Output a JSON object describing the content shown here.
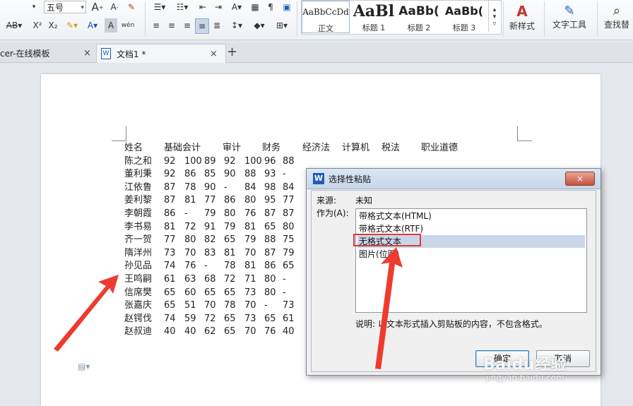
{
  "ribbon": {
    "font_size": "五号",
    "styles": [
      {
        "sample": "AaBbCcDd",
        "label": "正文"
      },
      {
        "sample": "AaBl",
        "label": "标题 1"
      },
      {
        "sample": "AaBb(",
        "label": "标题 2"
      },
      {
        "sample": "AaBb(",
        "label": "标题 3"
      }
    ],
    "new_style": "新样式",
    "text_tools": "文字工具",
    "find_replace": "查找替"
  },
  "tabs": {
    "template_tab": "cer-在线模板",
    "doc_tab": "文档1 *",
    "close_glyph": "×",
    "new_tab": "+"
  },
  "table": {
    "headers": [
      "姓名",
      "基础会计",
      "审计",
      "财务",
      "经济法",
      "计算机",
      "税法",
      "职业道德"
    ],
    "rows": [
      [
        "陈之和",
        "92",
        "100",
        "89",
        "92",
        "100",
        "96",
        "88"
      ],
      [
        "董利秉",
        "92",
        "86",
        "85",
        "90",
        "88",
        "93",
        "-"
      ],
      [
        "江依鲁",
        "87",
        "78",
        "90",
        "-",
        "84",
        "98",
        "84"
      ],
      [
        "姜利黎",
        "87",
        "81",
        "77",
        "86",
        "80",
        "95",
        "77"
      ],
      [
        "李朝霞",
        "86",
        "-",
        "79",
        "80",
        "76",
        "87",
        "87"
      ],
      [
        "李书易",
        "81",
        "72",
        "91",
        "79",
        "81",
        "65",
        "80"
      ],
      [
        "齐一贺",
        "77",
        "80",
        "82",
        "65",
        "79",
        "88",
        "75"
      ],
      [
        "隋洋州",
        "73",
        "70",
        "83",
        "81",
        "70",
        "87",
        "79"
      ],
      [
        "孙见品",
        "74",
        "76",
        "-",
        "78",
        "81",
        "86",
        "65"
      ],
      [
        "王鸣嗣",
        "61",
        "63",
        "68",
        "72",
        "71",
        "80",
        "-"
      ],
      [
        "信席樊",
        "65",
        "60",
        "65",
        "65",
        "73",
        "80",
        "-"
      ],
      [
        "张嘉庆",
        "65",
        "51",
        "70",
        "78",
        "70",
        "-",
        "73"
      ],
      [
        "赵锷伐",
        "74",
        "59",
        "72",
        "65",
        "73",
        "65",
        "61"
      ],
      [
        "赵叔迪",
        "40",
        "40",
        "62",
        "65",
        "70",
        "76",
        "40"
      ]
    ]
  },
  "dialog": {
    "title": "选择性粘贴",
    "close_glyph": "×",
    "source_label": "来源:",
    "source_value": "未知",
    "as_label": "作为(A):",
    "options": [
      "带格式文本(HTML)",
      "带格式文本(RTF)",
      "无格式文本",
      "图片(位图)"
    ],
    "selected_index": 2,
    "description": "说明: 以文本形式插入剪贴板的内容，不包含格式。",
    "ok": "确定",
    "cancel": "取消"
  },
  "watermark": {
    "logo": "Baidu经验",
    "url": "jingyan.baidu.com"
  },
  "colors": {
    "highlight_box": "#e03a3a",
    "arrow": "#ee3b2e",
    "selection": "#c8d6e8"
  }
}
